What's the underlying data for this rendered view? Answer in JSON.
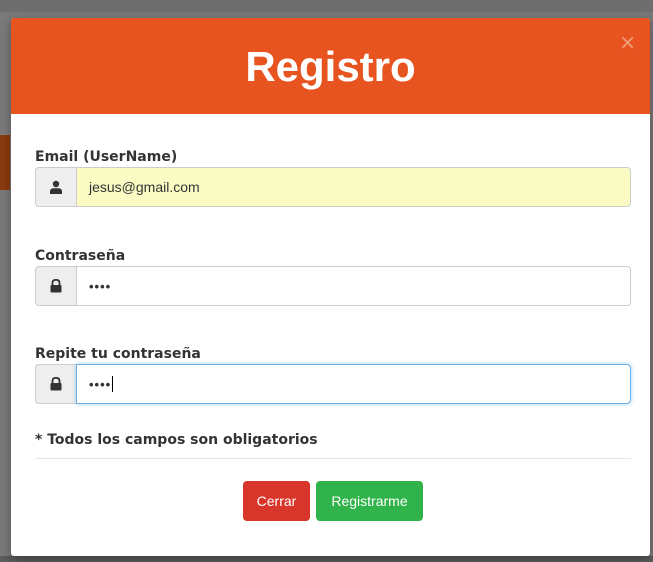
{
  "modal": {
    "title": "Registro",
    "close_symbol": "×"
  },
  "form": {
    "email": {
      "label": "Email (UserName)",
      "value": "jesus@gmail.com",
      "icon": "user-icon"
    },
    "password": {
      "label": "Contraseña",
      "value": "••••",
      "icon": "lock-icon"
    },
    "password_repeat": {
      "label": "Repite tu contraseña",
      "value": "••••",
      "icon": "lock-icon"
    },
    "required_note": "* Todos los campos son obligatorios"
  },
  "buttons": {
    "cancel_label": "Cerrar",
    "submit_label": "Registrarme"
  },
  "colors": {
    "header": "#e8541f",
    "cancel": "#d9362b",
    "submit": "#2fb34a",
    "autofill": "#fafcc4"
  }
}
